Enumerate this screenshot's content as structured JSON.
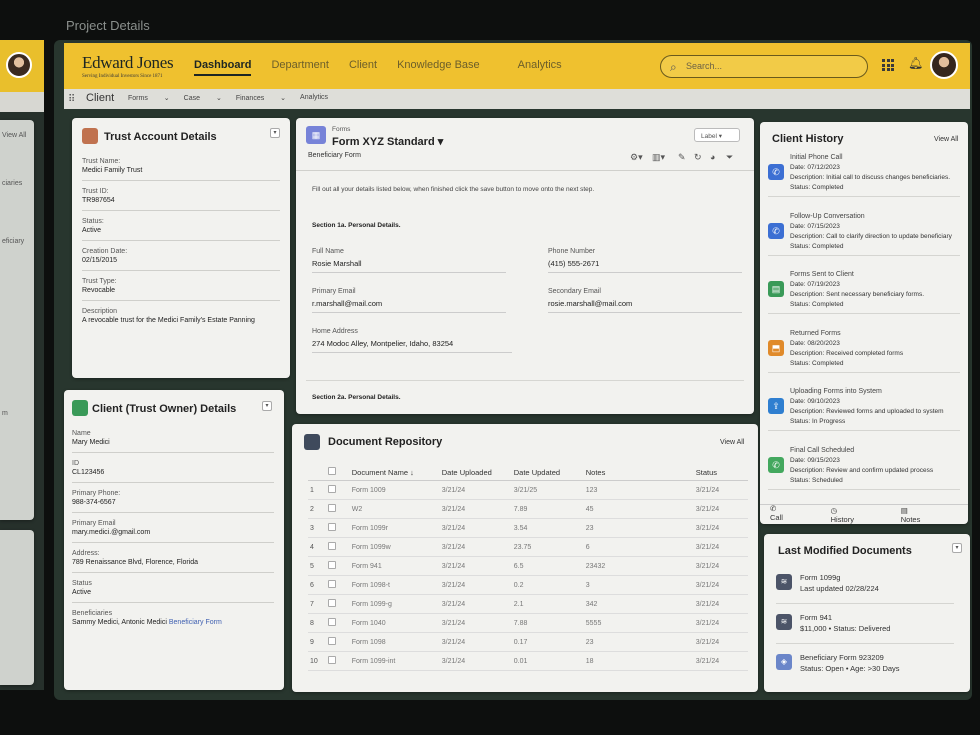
{
  "window_title": "Project Details",
  "back_panel": {
    "view_all": "View All",
    "labels": [
      "ciaries",
      "eficiary",
      "m"
    ]
  },
  "brand": {
    "name": "Edward Jones",
    "tagline": "Serving Individual Investors Since 1871"
  },
  "nav": [
    "Dashboard",
    "Department",
    "Client",
    "Knowledge Base",
    "Analytics"
  ],
  "search": {
    "placeholder": "Search..."
  },
  "subbar": {
    "app": "Client",
    "items": [
      "Forms",
      "Case",
      "Finances",
      "Analytics"
    ]
  },
  "trust": {
    "title": "Trust Account Details",
    "fields": [
      {
        "label": "Trust Name:",
        "value": "Medici Family Trust"
      },
      {
        "label": "Trust ID:",
        "value": "TR987654"
      },
      {
        "label": "Status:",
        "value": "Active"
      },
      {
        "label": "Creation Date:",
        "value": "02/15/2015"
      },
      {
        "label": "Trust Type:",
        "value": "Revocable"
      },
      {
        "label": "Description",
        "value": "A revocable trust for the Medici Family's Estate Panning"
      }
    ]
  },
  "owner": {
    "title": "Client (Trust Owner) Details",
    "fields": [
      {
        "label": "Name",
        "value": "Mary Medici"
      },
      {
        "label": "ID",
        "value": "CL123456"
      },
      {
        "label": "Primary Phone:",
        "value": "988-374-6567"
      },
      {
        "label": "Primary Email",
        "value": "mary.medici.@gmail.com"
      },
      {
        "label": "Address:",
        "value": "789 Renaissance Blvd, Florence, Florida"
      },
      {
        "label": "Status",
        "value": "Active"
      }
    ],
    "beneficiaries_label": "Beneficiaries",
    "beneficiaries_value": "Sammy Medici, Antonic Medici",
    "beneficiary_link": "Beneficiary Form"
  },
  "form": {
    "eyebrow": "Forms",
    "title": "Form XYZ Standard",
    "subtitle": "Beneficiary Form",
    "label_btn": "Label",
    "instructions": "Fill out all your details listed below, when finished click the save button to move onto the next step.",
    "section1": "Section 1a. Personal Details.",
    "full_name_label": "Full Name",
    "full_name": "Rosie Marshall",
    "phone_label": "Phone Number",
    "phone": "(415) 555-2671",
    "primary_email_label": "Primary Email",
    "primary_email": "r.marshall@mail.com",
    "secondary_email_label": "Secondary Email",
    "secondary_email": "rosie.marshall@mail.com",
    "home_address_label": "Home Address",
    "home_address": "274 Modoc Alley, Montpelier, Idaho, 83254",
    "section2": "Section 2a. Personal Details."
  },
  "docs": {
    "title": "Document Repository",
    "view_all": "View All",
    "columns": [
      "Document Name",
      "Date Uploaded",
      "Date Updated",
      "Notes",
      "Status"
    ],
    "rows": [
      [
        "1",
        "Form 1009",
        "3/21/24",
        "3/21/25",
        "123",
        "3/21/24"
      ],
      [
        "2",
        "W2",
        "3/21/24",
        "7.89",
        "45",
        "3/21/24"
      ],
      [
        "3",
        "Form 1099r",
        "3/21/24",
        "3.54",
        "23",
        "3/21/24"
      ],
      [
        "4",
        "Form 1099w",
        "3/21/24",
        "23.75",
        "6",
        "3/21/24"
      ],
      [
        "5",
        "Form 941",
        "3/21/24",
        "6.5",
        "23432",
        "3/21/24"
      ],
      [
        "6",
        "Form 1098-t",
        "3/21/24",
        "0.2",
        "3",
        "3/21/24"
      ],
      [
        "7",
        "Form 1099-g",
        "3/21/24",
        "2.1",
        "342",
        "3/21/24"
      ],
      [
        "8",
        "Form 1040",
        "3/21/24",
        "7.88",
        "5555",
        "3/21/24"
      ],
      [
        "9",
        "Form 1098",
        "3/21/24",
        "0.17",
        "23",
        "3/21/24"
      ],
      [
        "10",
        "Form 1099-int",
        "3/21/24",
        "0.01",
        "18",
        "3/21/24"
      ]
    ]
  },
  "history": {
    "title": "Client History",
    "view_all": "View All",
    "items": [
      {
        "title": "Initial Phone Call",
        "date": "Date: 07/12/2023",
        "desc": "Description: Initial call to discuss changes beneficiaries.",
        "status": "Status: Completed",
        "icon": "phone-icon",
        "color": "#3c6fd3"
      },
      {
        "title": "Follow-Up Conversation",
        "date": "Date: 07/15/2023",
        "desc": "Description: Call to clarify direction to update beneficiary",
        "status": "Status: Completed",
        "icon": "phone-icon",
        "color": "#3c6fd3"
      },
      {
        "title": "Forms Sent to Client",
        "date": "Date: 07/19/2023",
        "desc": "Description: Sent necessary beneficiary forms.",
        "status": "Status: Completed",
        "icon": "document-icon",
        "color": "#3a9a58"
      },
      {
        "title": "Returned Forms",
        "date": "Date: 08/20/2023",
        "desc": "Description: Received completed forms",
        "status": "Status: Completed",
        "icon": "inbox-icon",
        "color": "#e08a2a"
      },
      {
        "title": "Uploading Forms into System",
        "date": "Date: 09/10/2023",
        "desc": "Description: Reviewed forms and uploaded to system",
        "status": "Status: In Progress",
        "icon": "upload-icon",
        "color": "#2f7fd0"
      },
      {
        "title": "Final Call Scheduled",
        "date": "Date: 09/15/2023",
        "desc": "Description: Review and confirm updated process",
        "status": "Status: Scheduled",
        "icon": "phone-icon",
        "color": "#43a85e"
      }
    ],
    "tabs": [
      "Call",
      "History",
      "Notes"
    ]
  },
  "last_modified": {
    "title": "Last Modified Documents",
    "items": [
      {
        "line1": "Form 1099g",
        "line2": "Last updated 02/28/224"
      },
      {
        "line1": "Form 941",
        "line2": "$11,000 • Status: Delivered"
      },
      {
        "line1": "Beneficiary Form 923209",
        "line2": "Status: Open • Age: >30 Days"
      }
    ]
  },
  "colors": {
    "brand_yellow": "#efc12f",
    "frame_green": "#28362e"
  }
}
